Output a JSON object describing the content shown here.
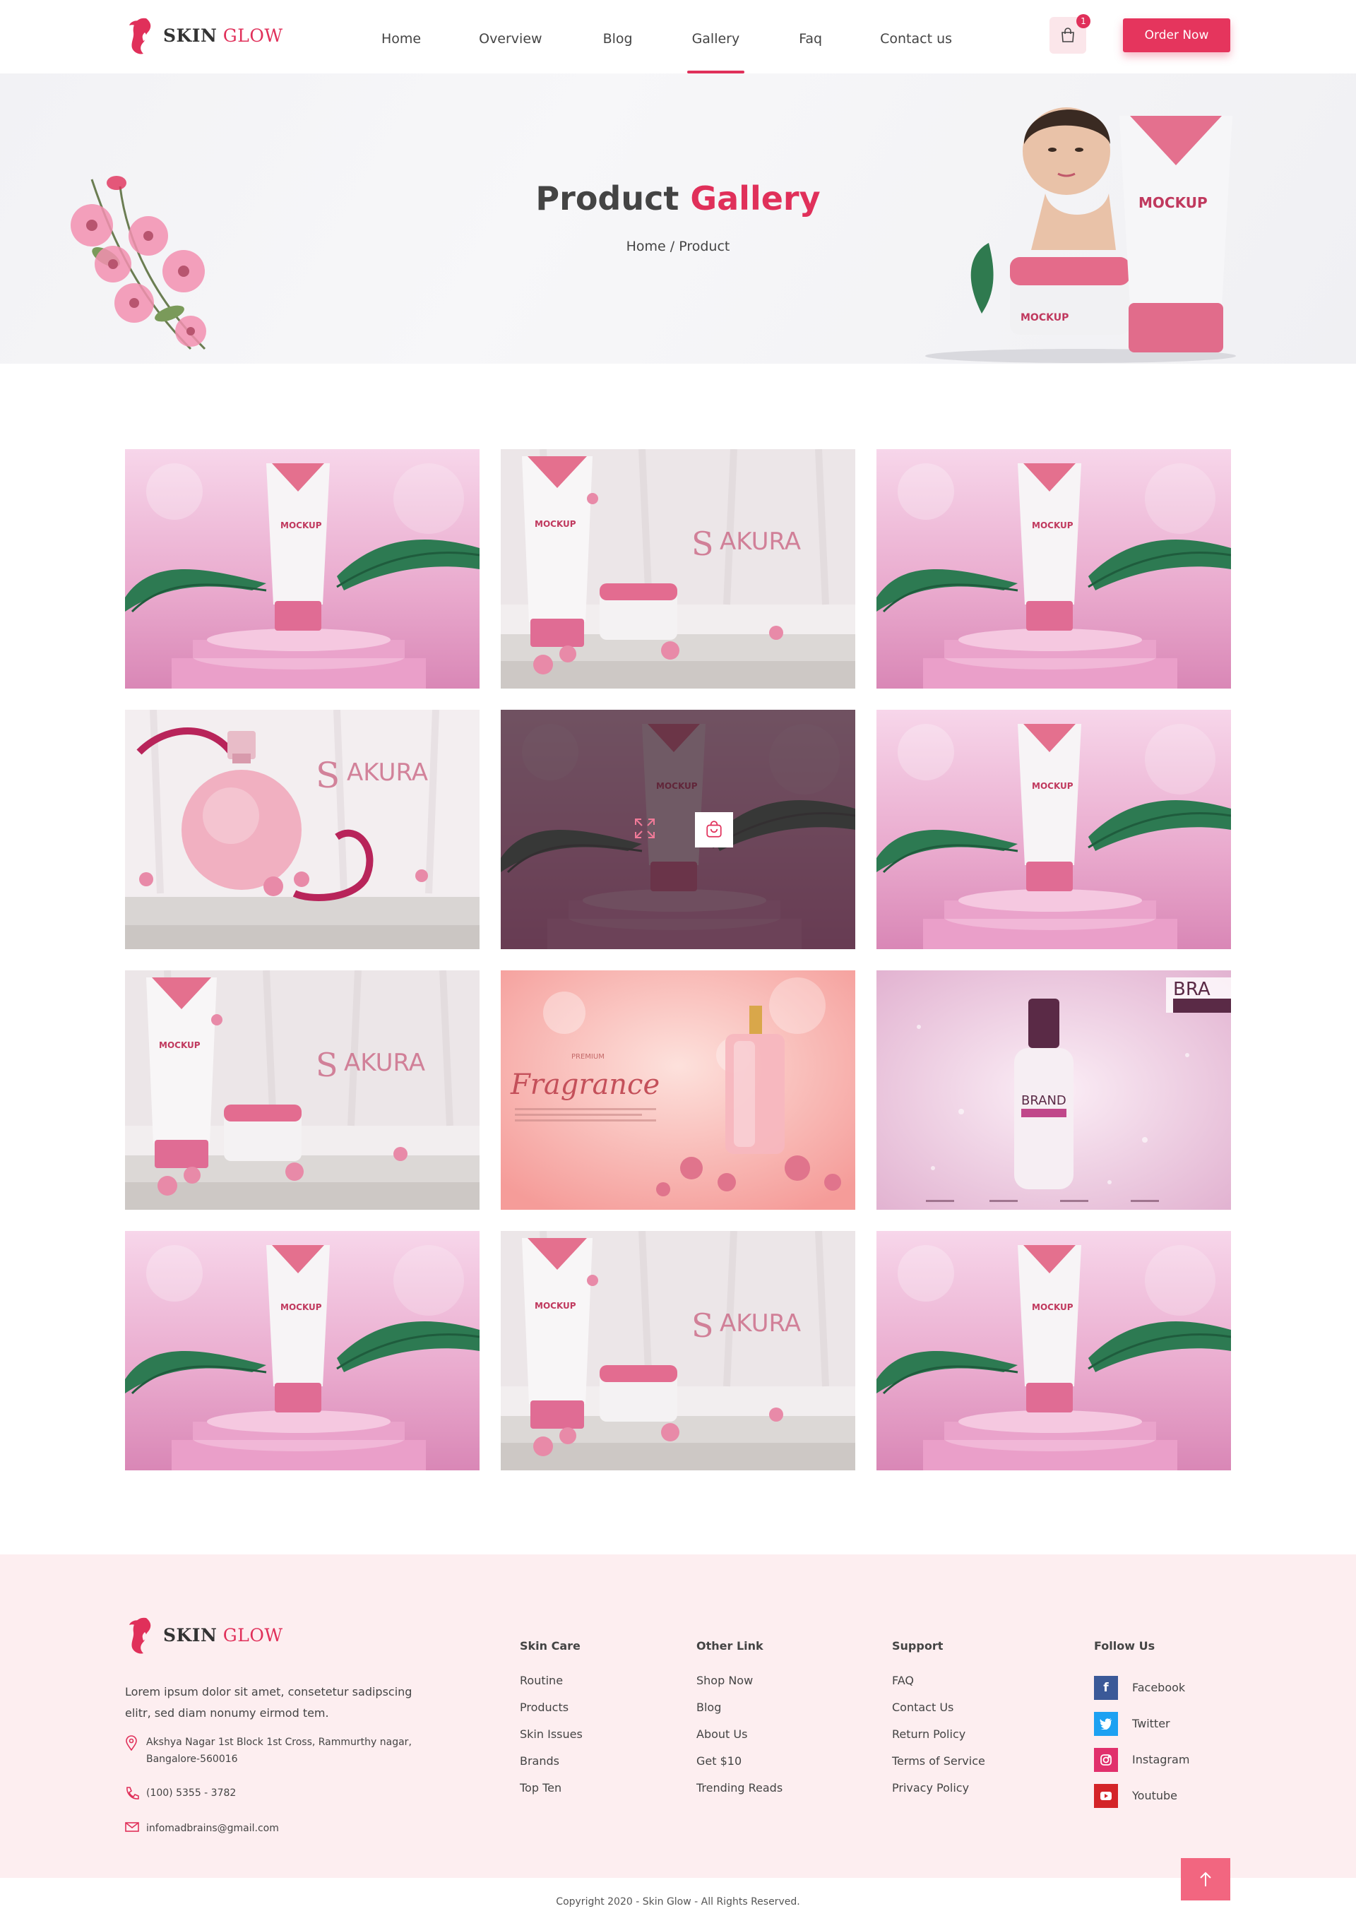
{
  "brand": {
    "name_part1": "SKIN",
    "name_part2": "GLOW",
    "accent_color": "#e0305a"
  },
  "nav": {
    "items": [
      {
        "label": "Home"
      },
      {
        "label": "Overview"
      },
      {
        "label": "Blog"
      },
      {
        "label": "Gallery",
        "active": true
      },
      {
        "label": "Faq"
      },
      {
        "label": "Contact us"
      }
    ],
    "cart_count": "1",
    "order_button": "Order Now"
  },
  "hero": {
    "title_part1": "Product",
    "title_part2": "Gallery",
    "breadcrumb": "Home / Product"
  },
  "gallery": {
    "tiles": [
      {
        "type": "podium"
      },
      {
        "type": "sakura-cream"
      },
      {
        "type": "podium"
      },
      {
        "type": "sakura-perfume"
      },
      {
        "type": "podium",
        "hovered": true
      },
      {
        "type": "podium"
      },
      {
        "type": "sakura-cream"
      },
      {
        "type": "fragrance"
      },
      {
        "type": "serum"
      },
      {
        "type": "podium"
      },
      {
        "type": "sakura-cream"
      },
      {
        "type": "podium"
      }
    ],
    "overlay_icons": [
      "expand-icon",
      "shopping-bag-icon"
    ]
  },
  "footer": {
    "description": "Lorem ipsum dolor sit amet, consetetur sadipscing elitr, sed diam nonumy eirmod tem.",
    "address": "Akshya Nagar 1st Block 1st Cross, Rammurthy nagar, Bangalore-560016",
    "phone": "(100) 5355 - 3782",
    "email": "infomadbrains@gmail.com",
    "columns": [
      {
        "title": "Skin Care",
        "links": [
          "Routine",
          "Products",
          "Skin Issues",
          "Brands",
          "Top Ten"
        ]
      },
      {
        "title": "Other Link",
        "links": [
          "Shop Now",
          "Blog",
          "About Us",
          "Get $10",
          "Trending Reads"
        ]
      },
      {
        "title": "Support",
        "links": [
          "FAQ",
          "Contact Us",
          "Return Policy",
          "Terms of Service",
          "Privacy Policy"
        ]
      }
    ],
    "follow": {
      "title": "Follow Us",
      "items": [
        {
          "label": "Facebook",
          "icon": "facebook-icon",
          "color": "#3b5998"
        },
        {
          "label": "Twitter",
          "icon": "twitter-icon",
          "color": "#1da1f2"
        },
        {
          "label": "Instagram",
          "icon": "instagram-icon",
          "color": "#e1306c"
        },
        {
          "label": "Youtube",
          "icon": "youtube-icon",
          "color": "#d42428"
        }
      ]
    },
    "copyright": "Copyright 2020 - Skin Glow - All Rights Reserved."
  }
}
